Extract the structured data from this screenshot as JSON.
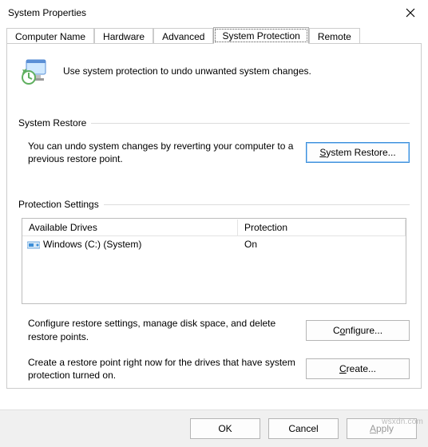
{
  "window": {
    "title": "System Properties"
  },
  "tabs": [
    {
      "label": "Computer Name"
    },
    {
      "label": "Hardware"
    },
    {
      "label": "Advanced"
    },
    {
      "label": "System Protection"
    },
    {
      "label": "Remote"
    }
  ],
  "intro": "Use system protection to undo unwanted system changes.",
  "groups": {
    "restore": {
      "label": "System Restore",
      "text": "You can undo system changes by reverting your computer to a previous restore point.",
      "button": "System Restore...",
      "button_u": "S"
    },
    "protection": {
      "label": "Protection Settings",
      "columns": {
        "a": "Available Drives",
        "b": "Protection"
      },
      "rows": [
        {
          "name": "Windows (C:) (System)",
          "protection": "On"
        }
      ],
      "configure_text": "Configure restore settings, manage disk space, and delete restore points.",
      "configure_btn": "Configure...",
      "configure_u": "o",
      "create_text": "Create a restore point right now for the drives that have system protection turned on.",
      "create_btn": "Create...",
      "create_u": "C"
    }
  },
  "footer": {
    "ok": "OK",
    "cancel": "Cancel",
    "apply": "Apply"
  },
  "watermark": "wsxdn.com"
}
